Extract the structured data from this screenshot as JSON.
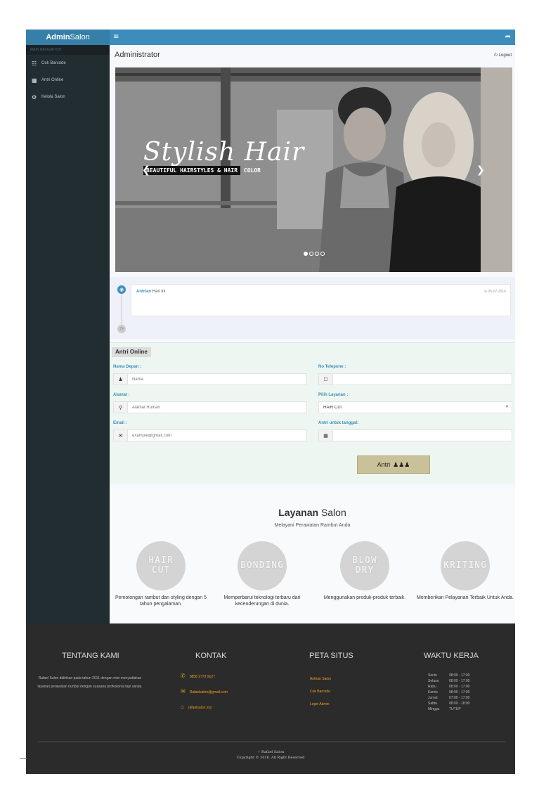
{
  "header": {
    "brand_bold": "Admin",
    "brand_rest": "Salon",
    "menu_icon": "bars-icon",
    "share_icon": "share-icon"
  },
  "sidebar": {
    "nav_header": "MAIN NAVIGATION",
    "items": [
      {
        "icon": "barcode-icon",
        "label": "Cek Barcode"
      },
      {
        "icon": "calendar-icon",
        "label": "Antri Online"
      },
      {
        "icon": "cog-icon",
        "label": "Kelola Salon"
      }
    ]
  },
  "page": {
    "title": "Administrator",
    "logout": "Logout"
  },
  "hero": {
    "title": "Stylish Hair",
    "subtitle_band": "BEAUTIFUL HAIRSTYLES & HAIR",
    "subtitle_rest": "COLOR",
    "slide_count": 4,
    "active_slide": 0
  },
  "timeline": {
    "highlight": "Antrian",
    "text": "Hari ini",
    "date": "05-07-2016"
  },
  "form": {
    "title": "Antri Online",
    "first_name_label": "Nama Depan :",
    "first_name_placeholder": "Nama",
    "phone_label": "No Telepone :",
    "address_label": "Alamat :",
    "address_placeholder": "Alamat Rumah",
    "service_label": "Pilih Layanan :",
    "service_value": "HAIR CUT",
    "email_label": "Email :",
    "email_placeholder": "example@gmail.com",
    "date_label": "Antri untuk tanggal:",
    "submit_label": "Antri"
  },
  "services": {
    "title_bold": "Layanan",
    "title_rest": "Salon",
    "subtitle": "Melayani Perawatan Rambut Anda",
    "items": [
      {
        "line1": "HAIR",
        "line2": "CUT",
        "desc": "Pemotongan rambut dan styling dengan 5 tahun pengalaman."
      },
      {
        "line1": "BONDING",
        "line2": "",
        "desc": "Memperbarui teknologi terbaru dari kecenderungan di dunia."
      },
      {
        "line1": "BLOW",
        "line2": "DRY",
        "desc": "Menggunakan produk-produk terbaik."
      },
      {
        "line1": "KRITING",
        "line2": "",
        "desc": "Memberikan Pelayanan Terbaik Untuk Anda."
      }
    ]
  },
  "footer": {
    "about_title": "TENTANG KAMI",
    "about_text": "Rafael Salon didirikan pada tahun 2011 dengan misi menyediakan layanan perawatan rambut dengan suasana profesional tapi santai.",
    "contact_title": "KONTAK",
    "phone": "0858 2773 9127",
    "email": "Rafaelsalon@gmail.com",
    "address": "rafaelsalon.xyz",
    "sitemap_title": "PETA SITUS",
    "links": [
      "Antrian Salon",
      "Cek Barcode",
      "Login Admin"
    ],
    "hours_title": "WAKTU KERJA",
    "hours": [
      {
        "day": "Senin",
        "time": "08:00 - 17:00"
      },
      {
        "day": "Selasa",
        "time": "08:00 - 17:00"
      },
      {
        "day": "Rabu",
        "time": "08:00 - 17:00"
      },
      {
        "day": "Kamis",
        "time": "08:00 - 17:00"
      },
      {
        "day": "Jumat",
        "time": "07:00 - 17:00"
      },
      {
        "day": "Sabtu",
        "time": "08:00 - 18:00"
      },
      {
        "day": "Minggu",
        "time": "TUTUP"
      }
    ],
    "brand": "Rafael Salon",
    "copyright": "Copyright © 2016. All Right Reserved"
  }
}
